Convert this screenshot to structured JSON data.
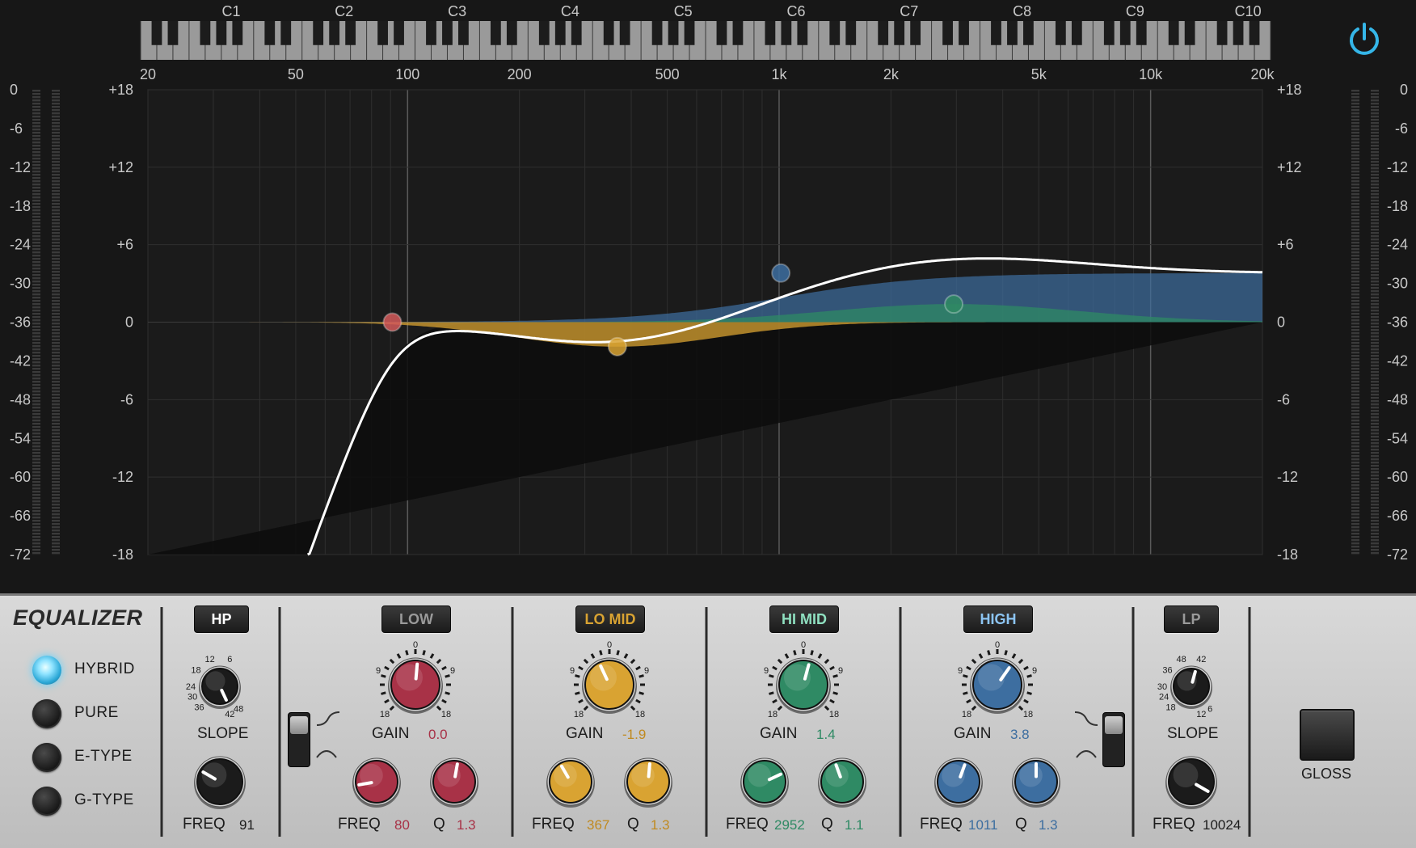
{
  "colors": {
    "hp": "#d35a5a",
    "low": "#a83247",
    "lomid": "#d9a332",
    "himid": "#2f8a64",
    "high": "#3d6ea0",
    "lp": "#888888",
    "curve": "#ffffff",
    "accent": "#35b6e8"
  },
  "keyboard": {
    "octaves": [
      "C1",
      "C2",
      "C3",
      "C4",
      "C5",
      "C6",
      "C7",
      "C8",
      "C9",
      "C10"
    ]
  },
  "freq_axis": {
    "labels": [
      "20",
      "50",
      "100",
      "200",
      "500",
      "1k",
      "2k",
      "5k",
      "10k",
      "20k"
    ],
    "values": [
      20,
      50,
      100,
      200,
      500,
      1000,
      2000,
      5000,
      10000,
      20000
    ]
  },
  "gain_axis": {
    "labels": [
      "+18",
      "+12",
      "+6",
      "0",
      "-6",
      "-12",
      "-18"
    ],
    "values": [
      18,
      12,
      6,
      0,
      -6,
      -12,
      -18
    ]
  },
  "meter_scale": {
    "labels": [
      "0",
      "-6",
      "-12",
      "-18",
      "-24",
      "-30",
      "-36",
      "-42",
      "-48",
      "-54",
      "-60",
      "-66",
      "-72"
    ]
  },
  "nodes": [
    {
      "band": "hp",
      "freq": 91,
      "gain": 0
    },
    {
      "band": "lomid",
      "freq": 367,
      "gain": -1.9
    },
    {
      "band": "high",
      "freq": 1011,
      "gain": 3.8
    },
    {
      "band": "himid",
      "freq": 2952,
      "gain": 1.4
    }
  ],
  "panel": {
    "title": "EQUALIZER",
    "modes": [
      {
        "label": "HYBRID",
        "active": true
      },
      {
        "label": "PURE",
        "active": false
      },
      {
        "label": "E-TYPE",
        "active": false
      },
      {
        "label": "G-TYPE",
        "active": false
      }
    ],
    "hp": {
      "button": "HP",
      "active": true,
      "slope_label": "SLOPE",
      "slope_scale": [
        "12",
        "6",
        "18",
        "24",
        "30",
        "36",
        "42",
        "48"
      ],
      "freq_label": "FREQ",
      "freq_value": "91"
    },
    "low": {
      "button": "LOW",
      "active": false,
      "gain_label": "GAIN",
      "gain_value": "0.0",
      "freq_label": "FREQ",
      "freq_value": "80",
      "q_label": "Q",
      "q_value": "1.3"
    },
    "lomid": {
      "button": "LO MID",
      "active": true,
      "gain_label": "GAIN",
      "gain_value": "-1.9",
      "freq_label": "FREQ",
      "freq_value": "367",
      "q_label": "Q",
      "q_value": "1.3"
    },
    "himid": {
      "button": "HI MID",
      "active": true,
      "gain_label": "GAIN",
      "gain_value": "1.4",
      "freq_label": "FREQ",
      "freq_value": "2952",
      "q_label": "Q",
      "q_value": "1.1"
    },
    "high": {
      "button": "HIGH",
      "active": true,
      "gain_label": "GAIN",
      "gain_value": "3.8",
      "freq_label": "FREQ",
      "freq_value": "1011",
      "q_label": "Q",
      "q_value": "1.3"
    },
    "lp": {
      "button": "LP",
      "active": false,
      "slope_label": "SLOPE",
      "slope_scale": [
        "6",
        "12",
        "18",
        "24",
        "30",
        "36",
        "42",
        "48"
      ],
      "freq_label": "FREQ",
      "freq_value": "10024"
    },
    "gain_scale": [
      "0",
      "9",
      "9",
      "18",
      "18"
    ],
    "gloss_label": "GLOSS"
  }
}
